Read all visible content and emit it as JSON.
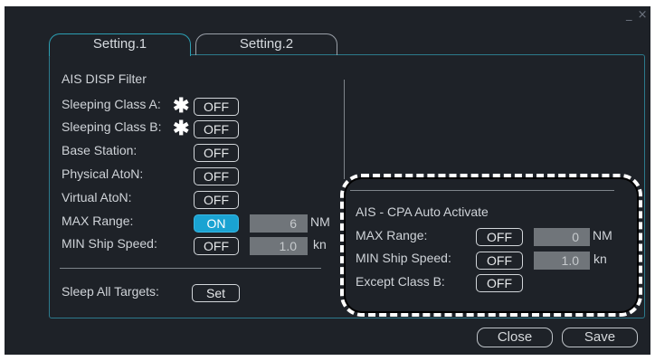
{
  "window": {
    "controls": "_ ×"
  },
  "tabs": [
    {
      "label": "Setting.1"
    },
    {
      "label": "Setting.2"
    }
  ],
  "ais_filter": {
    "title": "AIS DISP Filter",
    "rows": [
      {
        "label": "Sleeping Class A:",
        "value": "OFF",
        "marker": "✱"
      },
      {
        "label": "Sleeping Class B:",
        "value": "OFF",
        "marker": "✱"
      },
      {
        "label": "Base Station:",
        "value": "OFF"
      },
      {
        "label": "Physical AtoN:",
        "value": "OFF"
      },
      {
        "label": "Virtual AtoN:",
        "value": "OFF"
      },
      {
        "label": "MAX Range:",
        "value": "ON",
        "field": "6",
        "unit": "NM"
      },
      {
        "label": "MIN Ship Speed:",
        "value": "OFF",
        "field": "1.0",
        "unit": "kn"
      }
    ],
    "sleep_all_label": "Sleep All Targets:",
    "sleep_all_button": "Set"
  },
  "cpa": {
    "title": "AIS - CPA Auto Activate",
    "rows": [
      {
        "label": "MAX Range:",
        "value": "OFF",
        "field": "0",
        "unit": "NM"
      },
      {
        "label": "MIN Ship Speed:",
        "value": "OFF",
        "field": "1.0",
        "unit": "kn"
      },
      {
        "label": "Except Class B:",
        "value": "OFF"
      }
    ]
  },
  "footer": {
    "close": "Close",
    "save": "Save"
  },
  "colors": {
    "background": "#1e2228",
    "panel_border": "#2c7a8c",
    "on_button": "#1aa3d2",
    "field": "#70757a"
  }
}
